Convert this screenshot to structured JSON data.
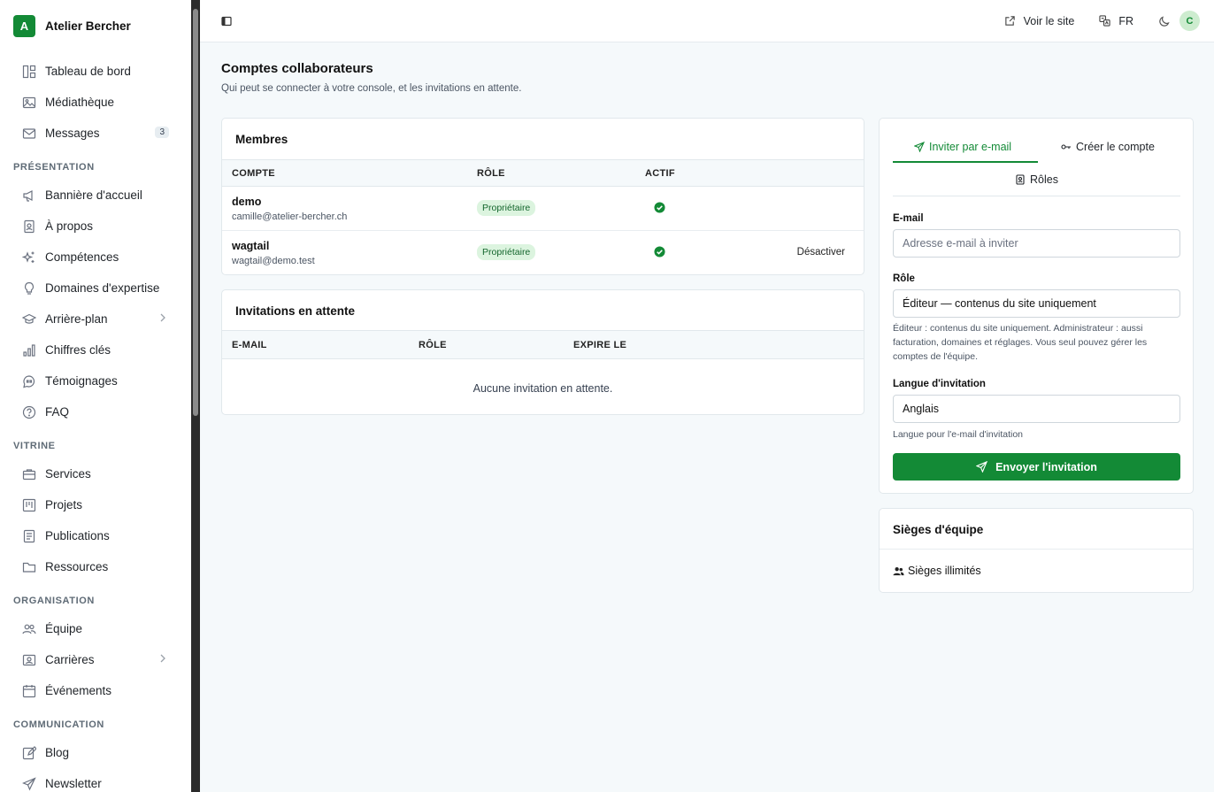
{
  "brand": {
    "initial": "A",
    "name": "Atelier Bercher"
  },
  "nav": {
    "dashboard": "Tableau de bord",
    "media": "Médiathèque",
    "messages": "Messages",
    "messages_count": "3",
    "section_presentation": "PRÉSENTATION",
    "banner": "Bannière d'accueil",
    "about": "À propos",
    "skills": "Compétences",
    "expertise": "Domaines d'expertise",
    "background": "Arrière-plan",
    "figures": "Chiffres clés",
    "testimonials": "Témoignages",
    "faq": "FAQ",
    "section_showcase": "VITRINE",
    "services": "Services",
    "projects": "Projets",
    "publications": "Publications",
    "resources": "Ressources",
    "section_organisation": "ORGANISATION",
    "team": "Équipe",
    "careers": "Carrières",
    "events": "Événements",
    "section_communication": "COMMUNICATION",
    "blog": "Blog",
    "newsletter": "Newsletter"
  },
  "topbar": {
    "view_site": "Voir le site",
    "language": "FR",
    "avatar_initial": "C"
  },
  "page": {
    "title": "Comptes collaborateurs",
    "subtitle": "Qui peut se connecter à votre console, et les invitations en attente."
  },
  "members": {
    "title": "Membres",
    "columns": {
      "account": "COMPTE",
      "role": "RÔLE",
      "active": "ACTIF"
    },
    "rows": [
      {
        "name": "demo",
        "email": "camille@atelier-bercher.ch",
        "role": "Propriétaire",
        "active": true,
        "action": ""
      },
      {
        "name": "wagtail",
        "email": "wagtail@demo.test",
        "role": "Propriétaire",
        "active": true,
        "action": "Désactiver"
      }
    ]
  },
  "invitations": {
    "title": "Invitations en attente",
    "columns": {
      "email": "E-MAIL",
      "role": "RÔLE",
      "expires": "EXPIRE LE"
    },
    "empty": "Aucune invitation en attente."
  },
  "invite_panel": {
    "tab_email": "Inviter par e-mail",
    "tab_create": "Créer le compte",
    "tab_roles": "Rôles",
    "email_label": "E-mail",
    "email_placeholder": "Adresse e-mail à inviter",
    "role_label": "Rôle",
    "role_value": "Éditeur — contenus du site uniquement",
    "role_help": "Éditeur : contenus du site uniquement. Administrateur : aussi facturation, domaines et réglages. Vous seul pouvez gérer les comptes de l'équipe.",
    "lang_label": "Langue d'invitation",
    "lang_value": "Anglais",
    "lang_help": "Langue pour l'e-mail d'invitation",
    "send": "Envoyer l'invitation"
  },
  "seats": {
    "title": "Sièges d'équipe",
    "value": "Sièges illimités"
  },
  "colors": {
    "accent": "#138a36",
    "badge_bg": "#dcf4df",
    "page_bg": "#f5f9fb"
  }
}
